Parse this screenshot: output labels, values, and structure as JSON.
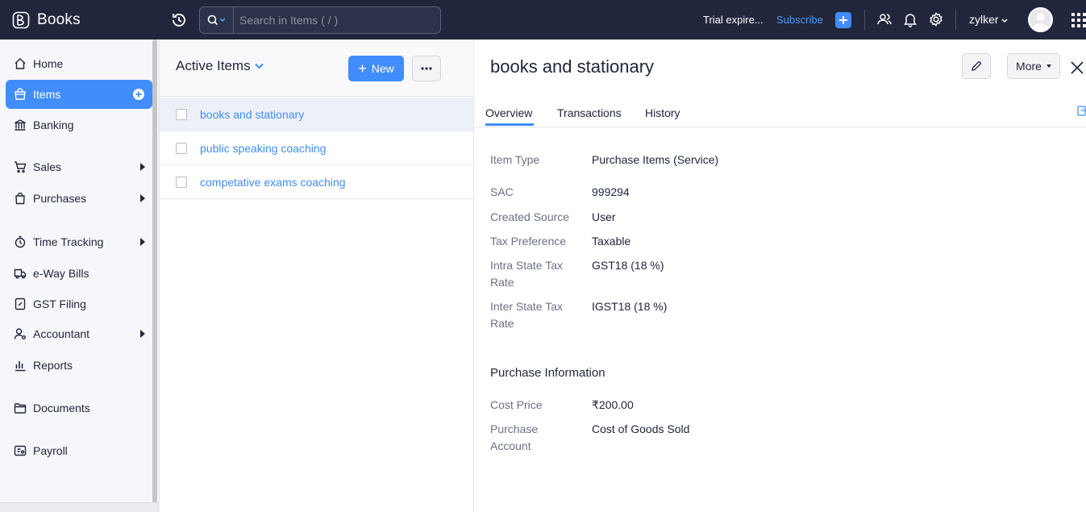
{
  "app": {
    "name": "Books"
  },
  "topbar": {
    "search_placeholder": "Search in Items ( / )",
    "trial_text": "Trial expire...",
    "subscribe_label": "Subscribe",
    "org_name": "zylker"
  },
  "sidebar": {
    "items": [
      {
        "label": "Home",
        "icon": "home-icon"
      },
      {
        "label": "Items",
        "icon": "items-icon",
        "active": true
      },
      {
        "label": "Banking",
        "icon": "bank-icon"
      },
      {
        "label": "Sales",
        "icon": "cart-icon",
        "expandable": true
      },
      {
        "label": "Purchases",
        "icon": "bag-icon",
        "expandable": true
      },
      {
        "label": "Time Tracking",
        "icon": "timer-icon",
        "expandable": true
      },
      {
        "label": "e-Way Bills",
        "icon": "truck-icon"
      },
      {
        "label": "GST Filing",
        "icon": "gst-icon"
      },
      {
        "label": "Accountant",
        "icon": "accountant-icon",
        "expandable": true
      },
      {
        "label": "Reports",
        "icon": "reports-icon"
      },
      {
        "label": "Documents",
        "icon": "folder-icon"
      },
      {
        "label": "Payroll",
        "icon": "payroll-icon"
      }
    ]
  },
  "list": {
    "view_title": "Active Items",
    "new_label": "New",
    "rows": [
      {
        "name": "books and stationary",
        "selected": true
      },
      {
        "name": "public speaking coaching",
        "selected": false
      },
      {
        "name": "competative exams coaching",
        "selected": false
      }
    ]
  },
  "detail": {
    "title": "books and stationary",
    "more_label": "More",
    "tabs": [
      "Overview",
      "Transactions",
      "History"
    ],
    "fields": [
      {
        "label": "Item Type",
        "value": "Purchase Items (Service)"
      },
      {
        "label": "SAC",
        "value": "999294"
      },
      {
        "label": "Created Source",
        "value": "User"
      },
      {
        "label": "Tax Preference",
        "value": "Taxable"
      },
      {
        "label": "Intra State Tax Rate",
        "value": "GST18 (18 %)"
      },
      {
        "label": "Inter State Tax Rate",
        "value": "IGST18 (18 %)"
      }
    ],
    "purchase_section_title": "Purchase Information",
    "purchase_fields": [
      {
        "label": "Cost Price",
        "value": "₹200.00"
      },
      {
        "label": "Purchase Account",
        "value": "Cost of Goods Sold"
      }
    ]
  },
  "colors": {
    "topbar": "#21263c",
    "accent": "#408dfb"
  }
}
